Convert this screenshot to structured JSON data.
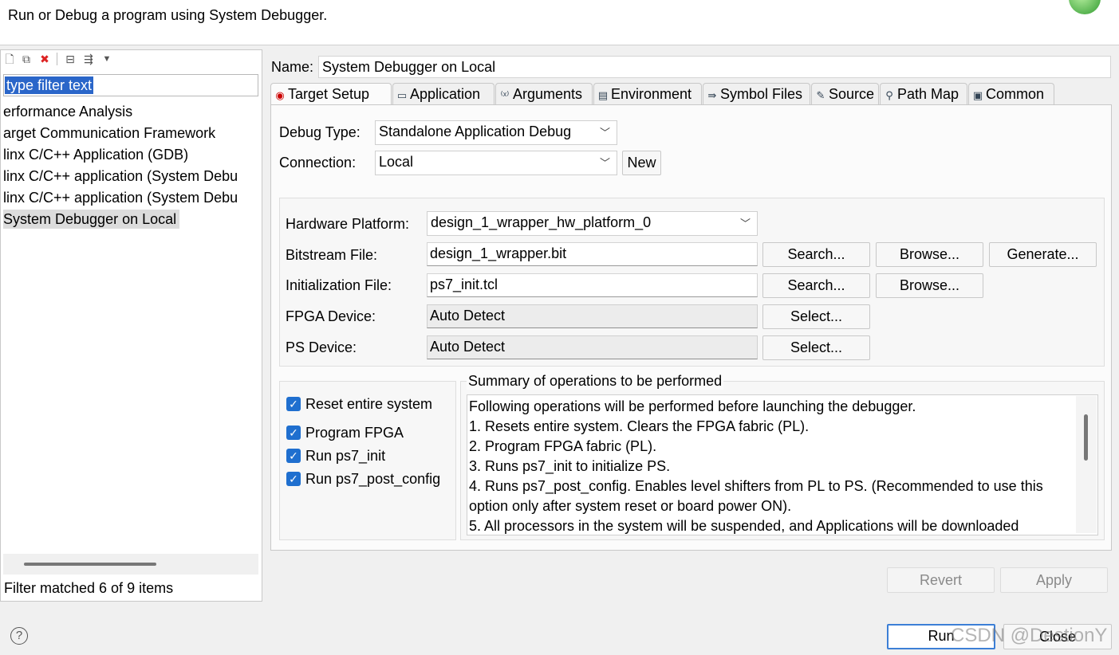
{
  "dialog": {
    "message": "Run or Debug a program using System Debugger."
  },
  "left_pane": {
    "toolbar_icons": [
      "new-config-icon",
      "duplicate-icon",
      "delete-icon",
      "collapse-all-icon",
      "filter-icon",
      "dropdown-icon"
    ],
    "filter_placeholder": "type filter text",
    "tree": [
      "erformance Analysis",
      "arget Communication Framework",
      "linx C/C++ Application (GDB)",
      "linx C/C++ application (System Debu",
      "linx C/C++ application (System Debu",
      "System Debugger on Local"
    ],
    "filter_status": "Filter matched 6 of 9 items"
  },
  "config": {
    "name_label": "Name:",
    "name_value": "System Debugger on Local",
    "tabs": [
      {
        "label": "Target Setup",
        "icon": "target-icon"
      },
      {
        "label": "Application",
        "icon": "application-icon"
      },
      {
        "label": "Arguments",
        "icon": "arguments-icon"
      },
      {
        "label": "Environment",
        "icon": "environment-icon"
      },
      {
        "label": "Symbol Files",
        "icon": "symbol-files-icon"
      },
      {
        "label": "Source",
        "icon": "source-icon"
      },
      {
        "label": "Path Map",
        "icon": "path-map-icon"
      },
      {
        "label": "Common",
        "icon": "common-icon"
      }
    ],
    "debug_type_label": "Debug Type:",
    "debug_type_value": "Standalone Application Debug",
    "connection_label": "Connection:",
    "connection_value": "Local",
    "new_button": "New",
    "hardware_platform_label": "Hardware Platform:",
    "hardware_platform_value": "design_1_wrapper_hw_platform_0",
    "bitstream_label": "Bitstream File:",
    "bitstream_value": "design_1_wrapper.bit",
    "init_label": "Initialization File:",
    "init_value": "ps7_init.tcl",
    "fpga_label": "FPGA Device:",
    "fpga_value": "Auto Detect",
    "ps_label": "PS Device:",
    "ps_value": "Auto Detect",
    "search_button": "Search...",
    "browse_button": "Browse...",
    "generate_button": "Generate...",
    "select_button": "Select...",
    "checkboxes": [
      {
        "label": "Reset entire system",
        "checked": true
      },
      {
        "label": "Program FPGA",
        "checked": true
      },
      {
        "label": "Run ps7_init",
        "checked": true
      },
      {
        "label": "Run ps7_post_config",
        "checked": true
      }
    ],
    "summary_title": "Summary of operations to be performed",
    "summary_text": "Following operations will be performed before launching the debugger.\n1. Resets entire system. Clears the FPGA fabric (PL).\n2. Program FPGA fabric (PL).\n3. Runs ps7_init to initialize PS.\n4. Runs ps7_post_config. Enables level shifters from PL to PS. (Recommended to use this option only after system reset or board power ON).\n5. All processors in the system will be suspended, and Applications will be downloaded"
  },
  "footer": {
    "revert_button": "Revert",
    "apply_button": "Apply",
    "run_button": "Run",
    "close_button": "Close",
    "help_icon": "?",
    "watermark": "CSDN @DestionY"
  }
}
